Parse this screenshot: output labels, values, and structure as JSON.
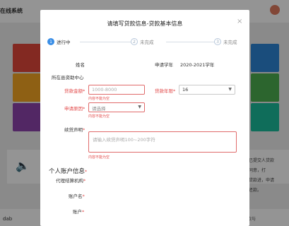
{
  "background": {
    "system_title": "在线系统",
    "notice_lines": [
      "记录已提交人贷款",
      "记的同意，打",
      "合同贷款进，申请",
      "及时还款。"
    ],
    "bottom_left": "dab",
    "bottom_right": "中心服务条款与",
    "tile_colors": [
      "#e2473b",
      "#2e86d6",
      "#f5a623",
      "#4caf50",
      "#8e44ad",
      "#1abc9c"
    ]
  },
  "modal": {
    "title": "请填写贷款信息-贷款基本信息",
    "close_glyph": "×",
    "steps": [
      {
        "number": "1",
        "label": "进行中",
        "state": "active"
      },
      {
        "number": "2",
        "label": "未完成",
        "state": "todo"
      },
      {
        "number": "3",
        "label": "未完成",
        "state": "todo"
      }
    ],
    "fields": {
      "name_label": "姓名",
      "school_year_label": "申请学年",
      "school_year_value": "2020-2021学年",
      "school_label": "所在县资助中心",
      "amount_label": "贷款金额",
      "amount_placeholder": "1000-8000",
      "amount_error": "内容不能为空",
      "term_label": "贷款年限",
      "term_value": "16",
      "reason_label": "申请原因",
      "reason_placeholder": "请选择",
      "reason_error": "内容不能为空",
      "statement_label": "续贷声明",
      "statement_placeholder": "请输入续贷声明100~200字符",
      "statement_error": "内容不能为空"
    },
    "account_section": {
      "title": "个人账户信息",
      "agency_label": "代理结算机构",
      "account_name_label": "账户名",
      "account_label": "账户"
    }
  }
}
